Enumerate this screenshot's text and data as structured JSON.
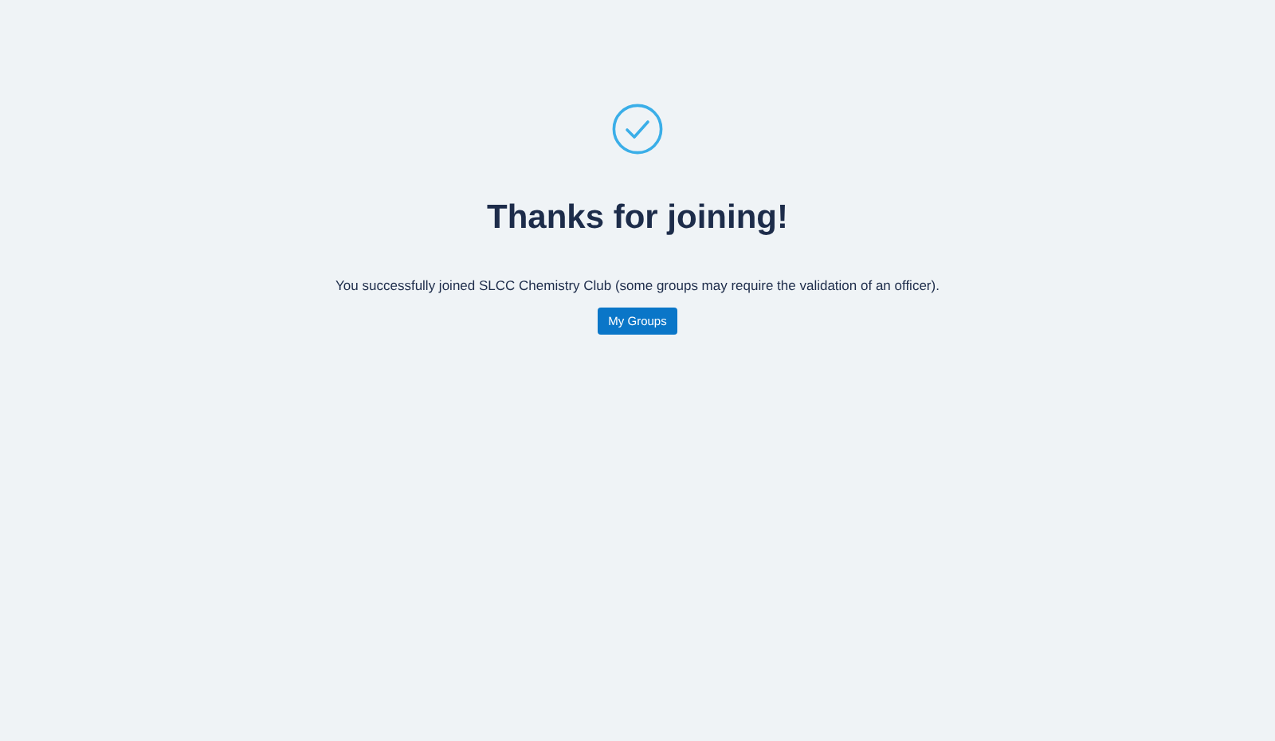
{
  "heading": "Thanks for joining!",
  "message": "You successfully joined SLCC Chemistry Club (some groups may require the validation of an officer).",
  "button": "My Groups"
}
